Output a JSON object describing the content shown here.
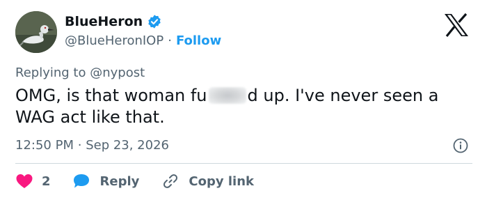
{
  "author": {
    "display_name": "BlueHeron",
    "handle": "@BlueHeronIOP",
    "separator": "·",
    "follow_label": "Follow"
  },
  "reply_context": {
    "prefix": "Replying to",
    "mention": "@nypost"
  },
  "tweet": {
    "text_before": "OMG, is that woman fu",
    "text_after": "d up. I've never seen a WAG act like that."
  },
  "meta": {
    "time": "12:50 PM",
    "separator": "·",
    "date": "Sep 23, 2026"
  },
  "actions": {
    "like_count": "2",
    "reply_label": "Reply",
    "copy_label": "Copy link"
  },
  "icons": {
    "verified": "verified-badge-icon",
    "logo": "x-logo-icon",
    "info": "info-icon",
    "like": "heart-icon",
    "reply": "speech-bubble-icon",
    "copy": "link-icon"
  },
  "colors": {
    "accent": "#1d9bf0",
    "like": "#f91880",
    "secondary_text": "#536471",
    "primary_text": "#0f1419",
    "divider": "#cfd9de"
  }
}
